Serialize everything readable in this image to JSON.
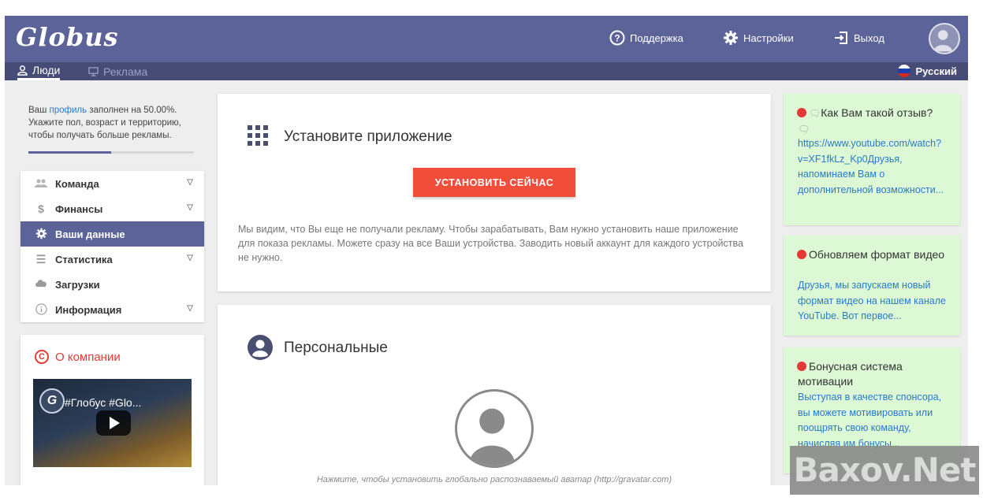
{
  "header": {
    "logo": "Globus",
    "support_label": "Поддержка",
    "settings_label": "Настройки",
    "logout_label": "Выход",
    "accent_color": "#5c6399"
  },
  "subnav": {
    "tabs": [
      {
        "label": "Люди",
        "active": true
      },
      {
        "label": "Реклама",
        "active": false
      }
    ],
    "language": "Русский"
  },
  "profile": {
    "text_before_link": "Ваш ",
    "link_text": "профиль",
    "text_after_link": " заполнен на 50.00%. Укажите пол, возраст и территорию, чтобы получать больше рекламы.",
    "completion_percent": 50
  },
  "menu": {
    "items": [
      {
        "label": "Команда",
        "icon": "team-icon",
        "expandable": true,
        "active": false
      },
      {
        "label": "Финансы",
        "icon": "dollar-icon",
        "expandable": true,
        "active": false
      },
      {
        "label": "Ваши данные",
        "icon": "gear-icon",
        "expandable": false,
        "active": true
      },
      {
        "label": "Статистика",
        "icon": "list-icon",
        "expandable": true,
        "active": false
      },
      {
        "label": "Загрузки",
        "icon": "cloud-icon",
        "expandable": false,
        "active": false
      },
      {
        "label": "Информация",
        "icon": "info-icon",
        "expandable": true,
        "active": false
      }
    ]
  },
  "company": {
    "title": "О компании",
    "video_caption": "#Глобус #Glo..."
  },
  "install": {
    "title": "Установите приложение",
    "button": "УСТАНОВИТЬ СЕЙЧАС",
    "text": "Мы видим, что Вы еще не получали рекламу. Чтобы зарабатывать, Вам нужно установить наше приложение для показа рекламы. Можете сразу на все Ваши устройства. Заводить новый аккаунт для каждого устройства не нужно."
  },
  "personal": {
    "title": "Персональные",
    "avatar_note": "Нажмите, чтобы установить глобально распознаваемый аватар (http://gravatar.com)"
  },
  "news": [
    {
      "title": "Как Вам такой отзыв?",
      "body": "https://www.youtube.com/watch?v=XF1fkLz_Kp0Друзья, напоминаем Вам о дополнительной возможности..."
    },
    {
      "title": "Обновляем формат видео",
      "body": "Друзья, мы запускаем новый формат видео на нашем канале YouTube. Вот первое..."
    },
    {
      "title": "Бонусная система мотивации",
      "body": "Выступая в качестве спонсора, вы можете мотивировать или поощрять свою команду, начисляя им бонусы..."
    }
  ],
  "watermark": "Baxov.Net"
}
